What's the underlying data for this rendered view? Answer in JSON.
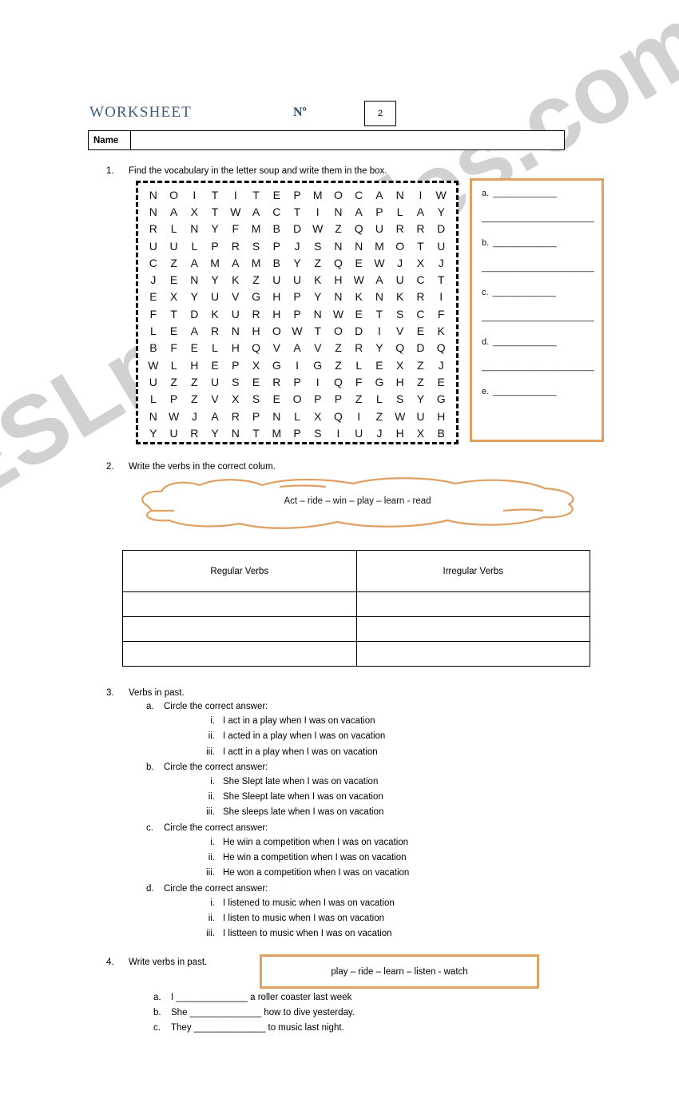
{
  "header": {
    "title": "WORKSHEET",
    "number_label": "Nº",
    "number_value": "2",
    "name_label": "Name",
    "name_value": ""
  },
  "section1": {
    "number": "1.",
    "instruction": "Find the vocabulary in the letter soup and write them in the box.",
    "grid": [
      [
        "N",
        "O",
        "I",
        "T",
        "I",
        "T",
        "E",
        "P",
        "M",
        "O",
        "C",
        "A",
        "N",
        "I",
        "W"
      ],
      [
        "N",
        "A",
        "X",
        "T",
        "W",
        "A",
        "C",
        "T",
        "I",
        "N",
        "A",
        "P",
        "L",
        "A",
        "Y"
      ],
      [
        "R",
        "L",
        "N",
        "Y",
        "F",
        "M",
        "B",
        "D",
        "W",
        "Z",
        "Q",
        "U",
        "R",
        "R",
        "D"
      ],
      [
        "U",
        "U",
        "L",
        "P",
        "R",
        "S",
        "P",
        "J",
        "S",
        "N",
        "N",
        "M",
        "O",
        "T",
        "U"
      ],
      [
        "C",
        "Z",
        "A",
        "M",
        "A",
        "M",
        "B",
        "Y",
        "Z",
        "Q",
        "E",
        "W",
        "J",
        "X",
        "J"
      ],
      [
        "J",
        "E",
        "N",
        "Y",
        "K",
        "Z",
        "U",
        "U",
        "K",
        "H",
        "W",
        "A",
        "U",
        "C",
        "T"
      ],
      [
        "E",
        "X",
        "Y",
        "U",
        "V",
        "G",
        "H",
        "P",
        "Y",
        "N",
        "K",
        "N",
        "K",
        "R",
        "I"
      ],
      [
        "F",
        "T",
        "D",
        "K",
        "U",
        "R",
        "H",
        "P",
        "N",
        "W",
        "E",
        "T",
        "S",
        "C",
        "F"
      ],
      [
        "L",
        "E",
        "A",
        "R",
        "N",
        "H",
        "O",
        "W",
        "T",
        "O",
        "D",
        "I",
        "V",
        "E",
        "K"
      ],
      [
        "B",
        "F",
        "E",
        "L",
        "H",
        "Q",
        "V",
        "A",
        "V",
        "Z",
        "R",
        "Y",
        "Q",
        "D",
        "Q"
      ],
      [
        "W",
        "L",
        "H",
        "E",
        "P",
        "X",
        "G",
        "I",
        "G",
        "Z",
        "L",
        "E",
        "X",
        "Z",
        "J"
      ],
      [
        "U",
        "Z",
        "Z",
        "U",
        "S",
        "E",
        "R",
        "P",
        "I",
        "Q",
        "F",
        "G",
        "H",
        "Z",
        "E"
      ],
      [
        "L",
        "P",
        "Z",
        "V",
        "X",
        "S",
        "E",
        "O",
        "P",
        "P",
        "Z",
        "L",
        "S",
        "Y",
        "G"
      ],
      [
        "N",
        "W",
        "J",
        "A",
        "R",
        "P",
        "N",
        "L",
        "X",
        "Q",
        "I",
        "Z",
        "W",
        "U",
        "H"
      ],
      [
        "Y",
        "U",
        "R",
        "Y",
        "N",
        "T",
        "M",
        "P",
        "S",
        "I",
        "U",
        "J",
        "H",
        "X",
        "B"
      ]
    ],
    "answer_box": {
      "labels": [
        "a.",
        "b.",
        "c.",
        "d.",
        "e."
      ],
      "blank": "_____________",
      "long_blank": "_______________________"
    }
  },
  "section2": {
    "number": "2.",
    "instruction": "Write the verbs in the correct colum.",
    "cloud_words": "Act – ride – win – play – learn - read",
    "table": {
      "headers": [
        "Regular Verbs",
        "Irregular Verbs"
      ],
      "rows": [
        [
          "",
          ""
        ],
        [
          "",
          ""
        ],
        [
          "",
          ""
        ]
      ]
    }
  },
  "section3": {
    "number": "3.",
    "instruction": "Verbs in past.",
    "groups": [
      {
        "alpha": "a.",
        "title": "Circle the correct answer:",
        "options": [
          {
            "rom": "i.",
            "text": "I act in a play when I was on vacation"
          },
          {
            "rom": "ii.",
            "text": "I acted in a play when I was on vacation"
          },
          {
            "rom": "iii.",
            "text": "I actt in a play when I was on vacation"
          }
        ]
      },
      {
        "alpha": "b.",
        "title": "Circle the correct answer:",
        "options": [
          {
            "rom": "i.",
            "text": "She Slept late when I was on vacation"
          },
          {
            "rom": "ii.",
            "text": "She Sleept late when I was on vacation"
          },
          {
            "rom": "iii.",
            "text": "She sleeps late when I was on vacation"
          }
        ]
      },
      {
        "alpha": "c.",
        "title": "Circle the correct answer:",
        "options": [
          {
            "rom": "i.",
            "text": "He wiin a competition when I was on vacation"
          },
          {
            "rom": "ii.",
            "text": "He win a competition when I was on vacation"
          },
          {
            "rom": "iii.",
            "text": "He won a competition when I was on vacation"
          }
        ]
      },
      {
        "alpha": "d.",
        "title": "Circle the correct answer:",
        "options": [
          {
            "rom": "i.",
            "text": "I listened to music when I was on vacation"
          },
          {
            "rom": "ii.",
            "text": "I listen to music when I was on vacation"
          },
          {
            "rom": "iii.",
            "text": "I listteen to music when I was on vacation"
          }
        ]
      }
    ]
  },
  "section4": {
    "number": "4.",
    "instruction": "Write verbs in past.",
    "word_bank": "play – ride – learn – listen - watch",
    "items": [
      {
        "alpha": "a.",
        "text": "I ______________ a roller coaster last week"
      },
      {
        "alpha": "b.",
        "text": "She ______________ how to dive yesterday."
      },
      {
        "alpha": "c.",
        "text": "They ______________ to music last night."
      }
    ]
  },
  "watermark": {
    "text": "ESLprintables.com"
  },
  "colors": {
    "accent_orange": "#e0a062",
    "title_blue": "#3f5c80",
    "watermark_gray": "#c9c9c9"
  }
}
